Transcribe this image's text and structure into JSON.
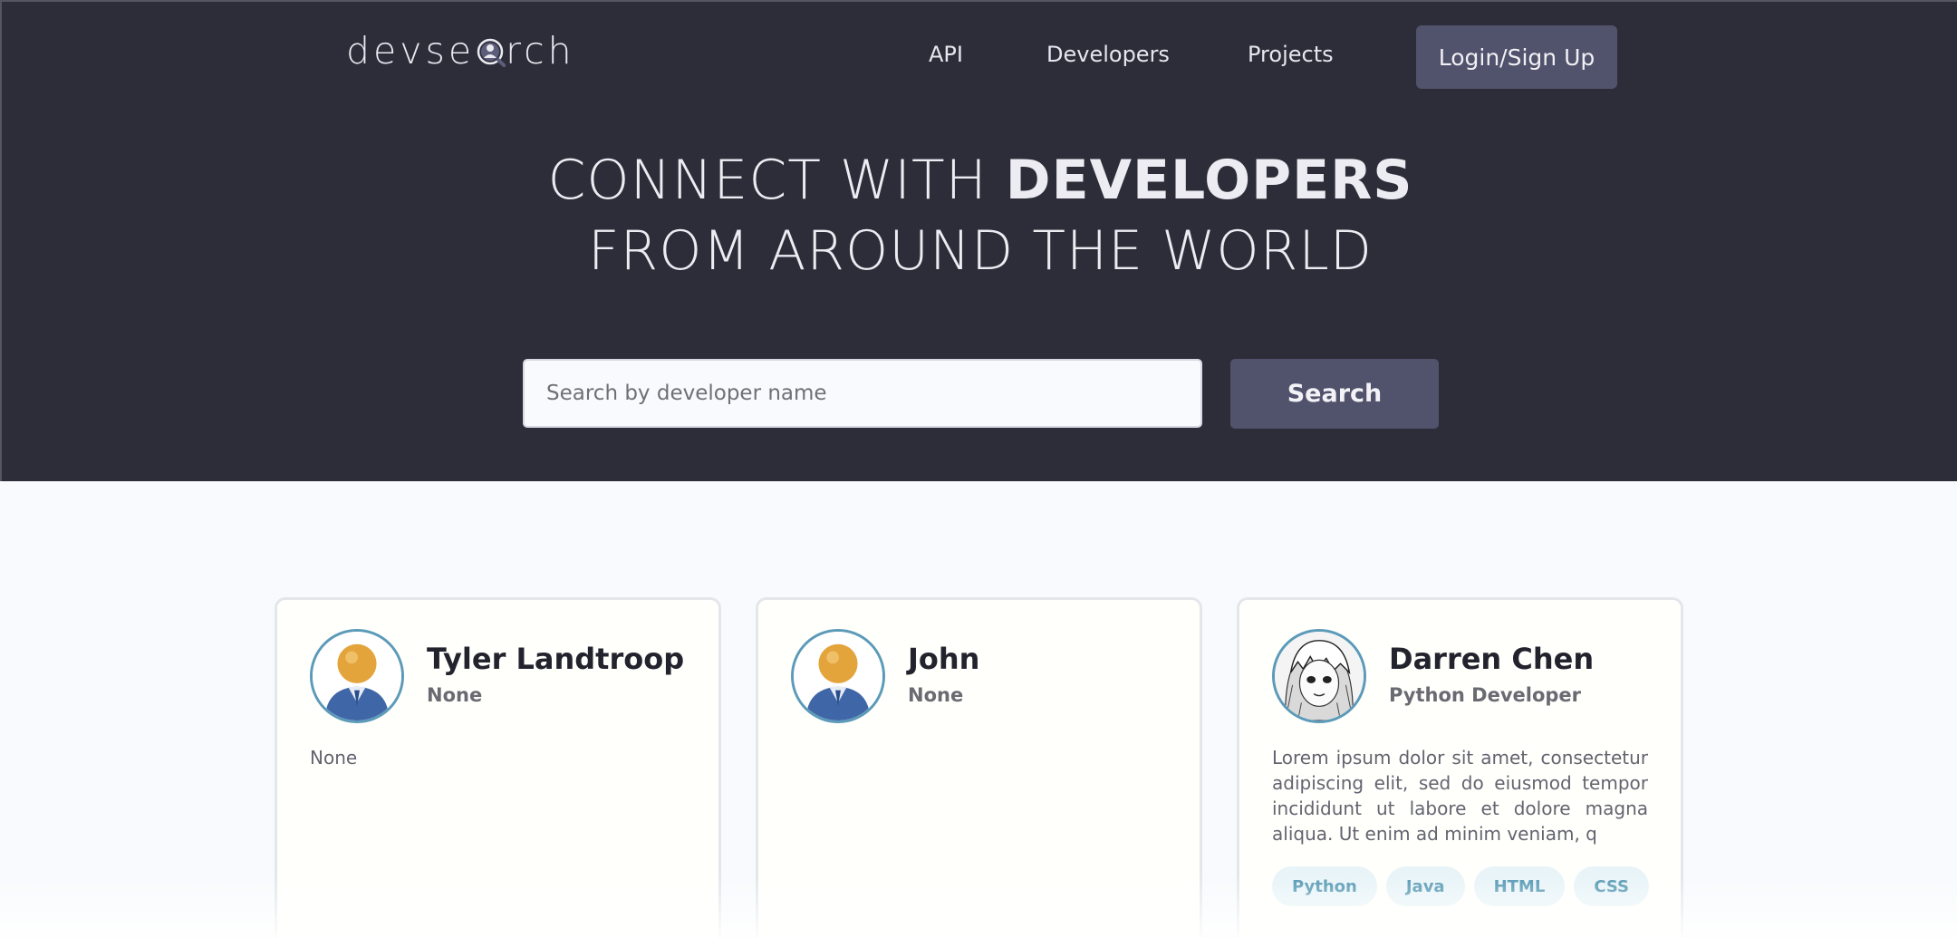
{
  "header": {
    "logo_prefix": "devse",
    "logo_suffix": "rch",
    "nav": [
      "API",
      "Developers",
      "Projects"
    ],
    "login_label": "Login/Sign Up"
  },
  "hero": {
    "title_line1_light": "CONNECT WITH ",
    "title_line1_bold": "DEVELOPERS",
    "title_line2": "FROM AROUND THE WORLD",
    "search_placeholder": "Search by developer name",
    "search_button": "Search"
  },
  "developers": [
    {
      "name": "Tyler Landtroop",
      "title": "None",
      "bio": "None",
      "avatar": "default-user-icon",
      "skills": []
    },
    {
      "name": "John",
      "title": "None",
      "bio": "",
      "avatar": "default-user-icon",
      "skills": []
    },
    {
      "name": "Darren Chen",
      "title": "Python Developer",
      "bio": "Lorem ipsum dolor sit amet, consectetur adipiscing elit, sed do eiusmod tempor incididunt ut labore et dolore magna aliqua. Ut enim ad minim veniam, q",
      "avatar": "anime-portrait",
      "skills": [
        "Python",
        "Java",
        "HTML",
        "CSS"
      ]
    }
  ],
  "colors": {
    "hero_bg": "#2d2d39",
    "button_bg": "#51526b",
    "page_bg": "#f8fafd",
    "tag_bg": "#e8f4f8",
    "tag_text": "#5497b2"
  }
}
